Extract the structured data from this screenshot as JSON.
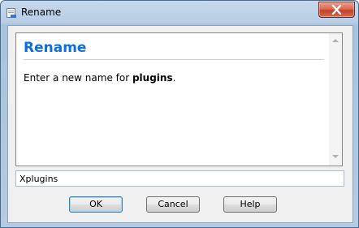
{
  "window": {
    "title": "Rename",
    "icons": {
      "app": "rename-dialog-icon",
      "close": "close-icon"
    },
    "colors": {
      "heading": "#0b6fe2",
      "close_button": "#c2412b"
    }
  },
  "dialog": {
    "heading": "Rename",
    "message_prefix": "Enter a new name for ",
    "message_name": "plugins",
    "message_suffix": "."
  },
  "input": {
    "value": "Xplugins"
  },
  "buttons": {
    "ok": "OK",
    "cancel": "Cancel",
    "help": "Help"
  }
}
